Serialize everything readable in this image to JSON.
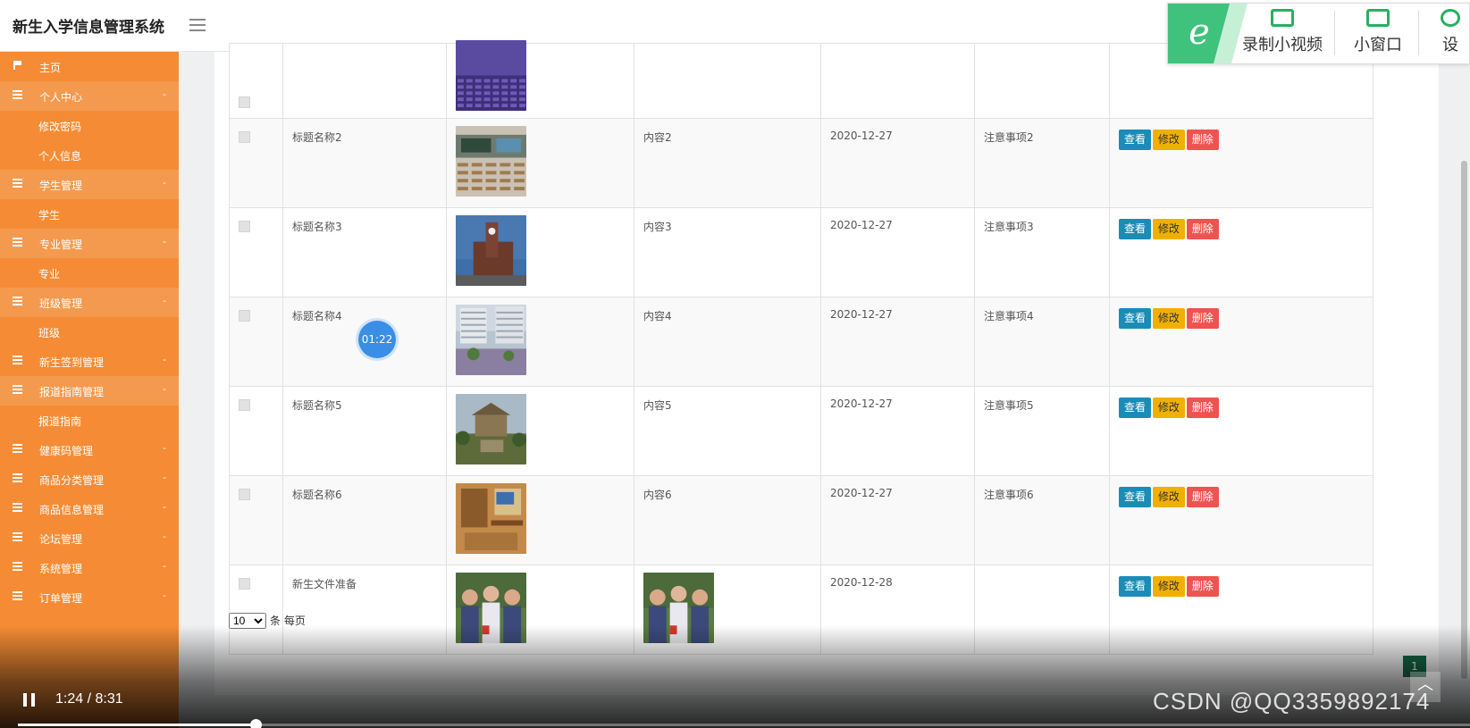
{
  "app": {
    "title": "新生入学信息管理系统"
  },
  "sidebar": {
    "items": [
      {
        "label": "主页",
        "type": "home"
      },
      {
        "label": "个人中心",
        "type": "parent",
        "arrow": "-"
      },
      {
        "label": "修改密码",
        "type": "child"
      },
      {
        "label": "个人信息",
        "type": "child"
      },
      {
        "label": "学生管理",
        "type": "parent",
        "arrow": "-"
      },
      {
        "label": "学生",
        "type": "child"
      },
      {
        "label": "专业管理",
        "type": "parent",
        "arrow": "-"
      },
      {
        "label": "专业",
        "type": "child"
      },
      {
        "label": "班级管理",
        "type": "parent",
        "arrow": "-"
      },
      {
        "label": "班级",
        "type": "child"
      },
      {
        "label": "新生签到管理",
        "type": "plain",
        "arrow": "-"
      },
      {
        "label": "报道指南管理",
        "type": "parent",
        "arrow": "-"
      },
      {
        "label": "报道指南",
        "type": "child"
      },
      {
        "label": "健康码管理",
        "type": "plain",
        "arrow": "-"
      },
      {
        "label": "商品分类管理",
        "type": "plain",
        "arrow": "-"
      },
      {
        "label": "商品信息管理",
        "type": "plain",
        "arrow": "-"
      },
      {
        "label": "论坛管理",
        "type": "plain",
        "arrow": "-"
      },
      {
        "label": "系统管理",
        "type": "plain",
        "arrow": "-"
      },
      {
        "label": "订单管理",
        "type": "plain",
        "arrow": "-"
      }
    ]
  },
  "table": {
    "actions": {
      "view": "查看",
      "edit": "修改",
      "delete": "删除"
    },
    "rows": [
      {
        "title": "",
        "content": "",
        "date": "",
        "notes": "",
        "image": "auditorium",
        "hasActions": false
      },
      {
        "title": "标题名称2",
        "content": "内容2",
        "date": "2020-12-27",
        "notes": "注意事项2",
        "image": "classroom",
        "hasActions": true
      },
      {
        "title": "标题名称3",
        "content": "内容3",
        "date": "2020-12-27",
        "notes": "注意事项3",
        "image": "clocktower",
        "hasActions": true
      },
      {
        "title": "标题名称4",
        "content": "内容4",
        "date": "2020-12-27",
        "notes": "注意事项4",
        "image": "campus",
        "hasActions": true
      },
      {
        "title": "标题名称5",
        "content": "内容5",
        "date": "2020-12-27",
        "notes": "注意事项5",
        "image": "pavilion",
        "hasActions": true
      },
      {
        "title": "标题名称6",
        "content": "内容6",
        "date": "2020-12-27",
        "notes": "注意事项6",
        "image": "dorm",
        "hasActions": true
      },
      {
        "title": "新生文件准备",
        "content": "",
        "date": "2020-12-28",
        "notes": "",
        "image": "students",
        "contentImage": "students",
        "hasActions": true
      }
    ]
  },
  "pager": {
    "page_size": "10",
    "suffix": "条 每页",
    "current_page": "1"
  },
  "toolbar": {
    "record_label": "录制小视频",
    "window_label": "小窗口",
    "settings_label": "设"
  },
  "player": {
    "elapsed": "1:24 / 8:31",
    "progress": 0.164,
    "timer_badge": "01:22",
    "watermark": "CSDN @QQ3359892174"
  },
  "colors": {
    "sidebar": "#f58c35",
    "view_btn": "#1a8cb8",
    "edit_btn": "#f0b000",
    "delete_btn": "#ef5350"
  }
}
